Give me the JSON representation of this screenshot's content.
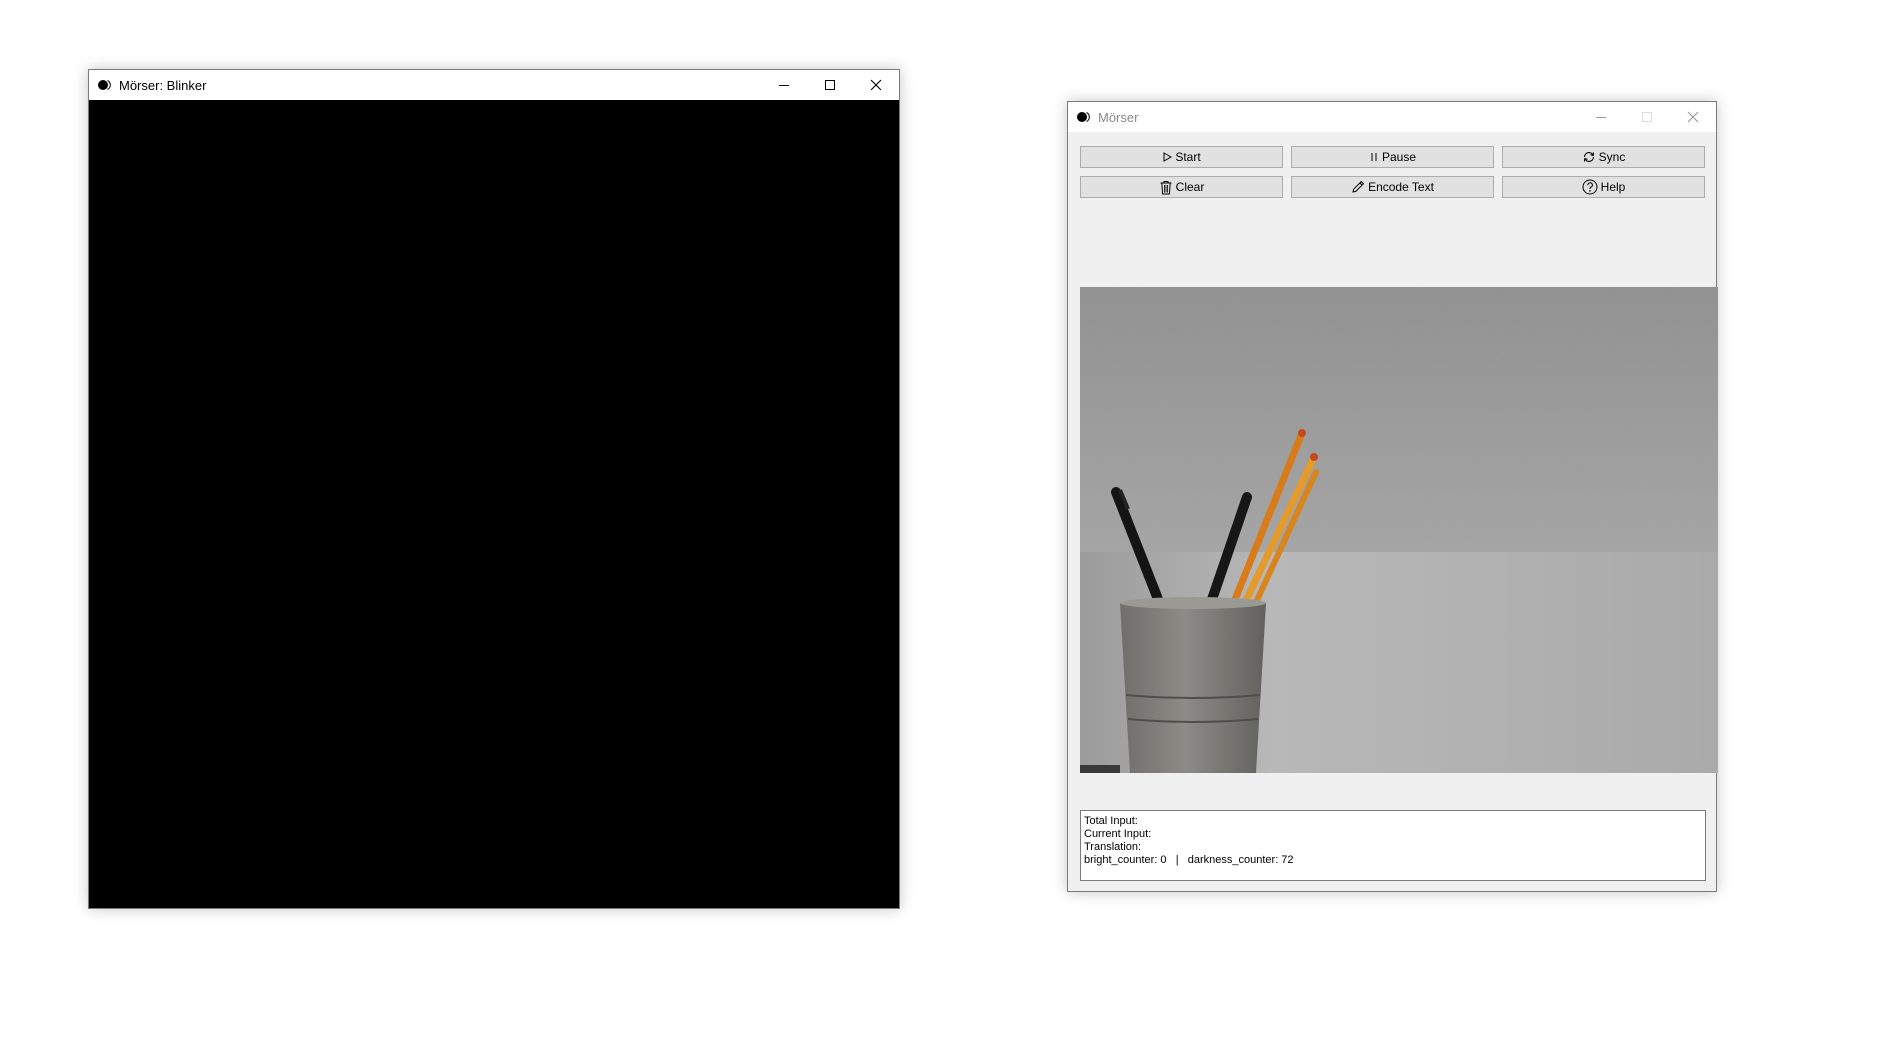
{
  "blinker_window": {
    "title": "Mörser: Blinker"
  },
  "main_window": {
    "title": "Mörser",
    "buttons": {
      "start": "Start",
      "pause": "Pause",
      "sync": "Sync",
      "clear": "Clear",
      "encode_text": "Encode Text",
      "help": "Help"
    },
    "status": {
      "total_input": "Total Input:",
      "current_input": "Current Input:",
      "translation": "Translation:",
      "counters": "bright_counter: 0   |   darkness_counter: 72"
    }
  },
  "icons": [
    "app-icon",
    "minimize-icon",
    "maximize-icon",
    "close-icon",
    "play-icon",
    "pause-icon",
    "sync-icon",
    "trash-icon",
    "pencil-icon",
    "help-icon"
  ],
  "colors": {
    "blinker_canvas": "#000000",
    "dialog_background": "#f0f0f0",
    "button_face": "#e1e1e1",
    "button_border": "#adadad"
  }
}
